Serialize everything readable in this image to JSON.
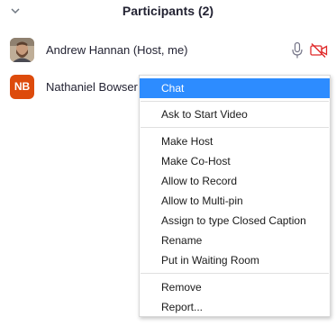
{
  "panel": {
    "title": "Participants (2)"
  },
  "participants": [
    {
      "name": "Andrew Hannan (Host, me)",
      "avatar": "photo"
    },
    {
      "name": "Nathaniel Bowser",
      "initials": "NB",
      "avatar_color": "#dd4b0c"
    }
  ],
  "icons": {
    "collapse": "chevron-down-icon",
    "mic": "microphone-icon",
    "video_off": "video-off-icon"
  },
  "colors": {
    "highlight": "#2d8cff",
    "video_off": "#e02828",
    "initials_avatar": "#dd4b0c"
  },
  "context_menu": {
    "items": [
      {
        "label": "Chat"
      },
      {
        "label": "Ask to Start Video"
      },
      {
        "label": "Make Host"
      },
      {
        "label": "Make Co-Host"
      },
      {
        "label": "Allow to Record"
      },
      {
        "label": "Allow to Multi-pin"
      },
      {
        "label": "Assign to type Closed Caption"
      },
      {
        "label": "Rename"
      },
      {
        "label": "Put in Waiting Room"
      },
      {
        "label": "Remove"
      },
      {
        "label": "Report..."
      }
    ],
    "highlighted": "Chat"
  }
}
